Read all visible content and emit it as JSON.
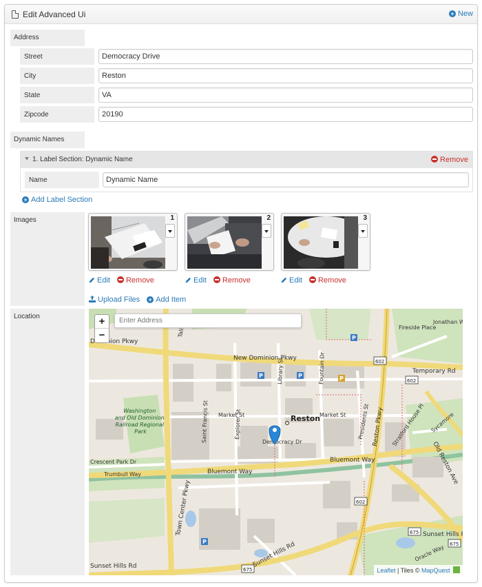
{
  "header": {
    "title": "Edit Advanced Ui",
    "new_label": "New"
  },
  "address": {
    "section_label": "Address",
    "fields": [
      {
        "label": "Street",
        "value": "Democracy Drive"
      },
      {
        "label": "City",
        "value": "Reston"
      },
      {
        "label": "State",
        "value": "VA"
      },
      {
        "label": "Zipcode",
        "value": "20190"
      }
    ]
  },
  "dynamic_names": {
    "section_label": "Dynamic Names",
    "item_title": "1. Label Section: Dynamic Name",
    "remove_label": "Remove",
    "name_label": "Name",
    "name_value": "Dynamic Name",
    "add_label": "Add Label Section"
  },
  "images": {
    "section_label": "Images",
    "items": [
      {
        "number": "1",
        "edit_label": "Edit",
        "remove_label": "Remove"
      },
      {
        "number": "2",
        "edit_label": "Edit",
        "remove_label": "Remove"
      },
      {
        "number": "3",
        "edit_label": "Edit",
        "remove_label": "Remove"
      }
    ],
    "upload_label": "Upload Files",
    "add_item_label": "Add Item"
  },
  "location": {
    "section_label": "Location",
    "search_placeholder": "Enter Address",
    "zoom_in": "+",
    "zoom_out": "−",
    "attribution": {
      "leaflet": "Leaflet",
      "separator": " | Tiles © ",
      "mapquest": "MapQuest"
    },
    "map_labels": {
      "town": "Reston",
      "new_dominion": "New Dominion Pkwy",
      "dominion": "Dominion Pkwy",
      "temporary": "Temporary Rd",
      "market_st_1": "Market St",
      "market_st_2": "Market St",
      "democracy": "Democracy Dr",
      "bluemont_1": "Bluemont Way",
      "bluemont_2": "Bluemont Way",
      "crescent": "Crescent Park Dr",
      "trumbull": "Trumbull Way",
      "sunset_hills_1": "Sunset Hills Rd",
      "sunset_hills_2": "Sunset Hills Rd",
      "sunset_hills_3": "Sunset Hills Rd",
      "town_center": "Town Center Pkwy",
      "reston_pkwy": "Reston Pkwy",
      "old_reston": "Old Reston Ave",
      "railroad_park": "Washington and Old Dominion Railroad Regional Park",
      "explorer": "Explorer St",
      "saint_francis": "Saint Francis St",
      "library": "Library St",
      "fountain": "Fountain Dr",
      "presidents": "Presidents St",
      "stratford": "Stratford House Pl",
      "sycamore": "Sycamore",
      "fireside": "Fireside Place",
      "jonathan": "Jonathan Way",
      "oracle": "Oracle Way",
      "talisman": "Talisman",
      "rt602a": "602",
      "rt602b": "602",
      "rt602c": "602",
      "rt675a": "675",
      "rt675b": "675",
      "rt675c": "675"
    }
  }
}
